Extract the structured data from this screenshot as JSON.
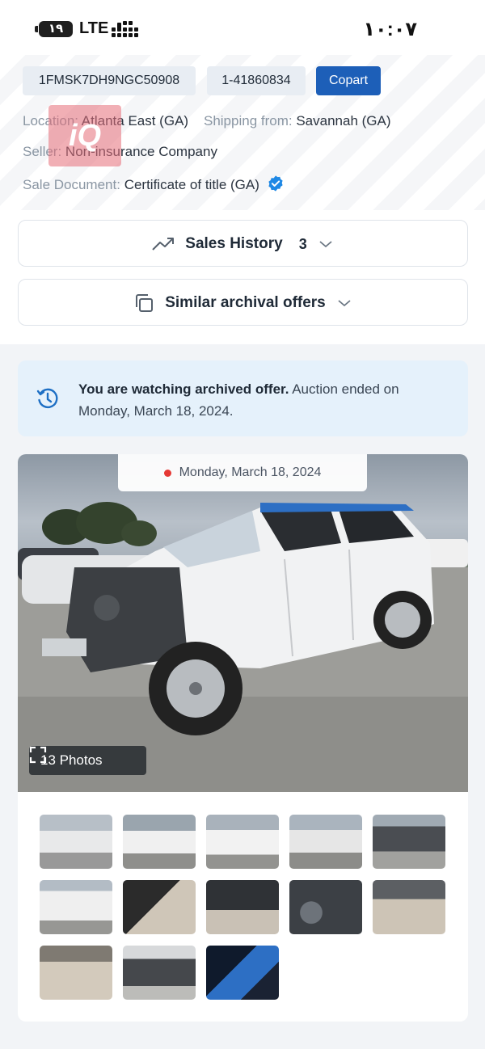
{
  "status_bar": {
    "battery": "١٩",
    "network": "LTE",
    "time": "١٠:٠٧"
  },
  "watermark": "iQ",
  "lot": {
    "vin": "1FMSK7DH9NGC50908",
    "lot_number": "1-41860834",
    "auction": "Copart",
    "location_label": "Location:",
    "location": "Atlanta East (GA)",
    "shipping_label": "Shipping from:",
    "shipping": "Savannah (GA)",
    "seller_label": "Seller:",
    "seller": "Non-insurance Company",
    "doc_label": "Sale Document:",
    "doc": "Certificate of title (GA)"
  },
  "sales_history": {
    "label": "Sales History",
    "count": "3"
  },
  "similar": {
    "label": "Similar archival offers"
  },
  "notice": {
    "bold": "You are watching archived offer.",
    "rest": " Auction ended on Monday, March 18, 2024."
  },
  "photo": {
    "date": "Monday, March 18, 2024",
    "photos_label": "13 Photos"
  },
  "thumbnails": [
    "front-left-damaged",
    "left-side",
    "rear-left",
    "front-left-close",
    "front-engine",
    "rear",
    "interior-driver",
    "dashboard",
    "instrument-cluster",
    "rear-seats",
    "front-seats",
    "engine-bay",
    "airbag"
  ],
  "colors": {
    "accent": "#1d5fb8",
    "notice_bg": "#e5f1fb",
    "verified": "#1e88e5",
    "live_dot": "#e53935"
  }
}
